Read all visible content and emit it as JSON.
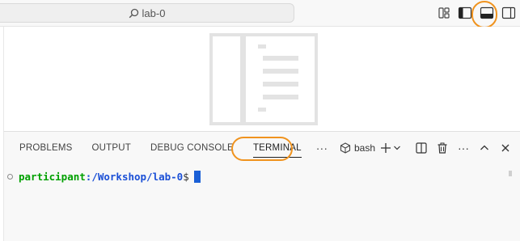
{
  "titlebar": {
    "search_label": "lab-0",
    "search_icon": "search-icon",
    "layout_icons": [
      "customize-layout-icon",
      "toggle-primary-sidebar-icon",
      "toggle-panel-icon",
      "toggle-secondary-sidebar-icon"
    ]
  },
  "highlight_color": "#f0931e",
  "panel": {
    "tabs": [
      "PROBLEMS",
      "OUTPUT",
      "DEBUG CONSOLE",
      "TERMINAL"
    ],
    "active_tab": "TERMINAL",
    "more_tabs": "···",
    "shell_name": "bash",
    "more_actions": "···"
  },
  "terminal": {
    "user": "participant",
    "path": ":/Workshop/lab-0",
    "prompt": "$"
  },
  "colors": {
    "user": "#00a000",
    "path": "#1a4fd6",
    "cursor": "#1a5fd6",
    "accent_highlight": "#f0931e"
  }
}
